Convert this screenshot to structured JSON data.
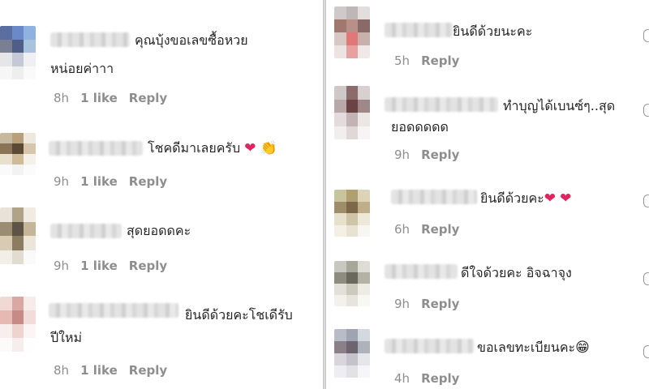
{
  "left": [
    {
      "text_line1": "คุณบุ้งขอเลขซื้อหวย",
      "text_line2": "หน่อยค่าาา",
      "time": "8h",
      "likes": "1 like",
      "reply": "Reply"
    },
    {
      "text_line1": "โชคดีมาเลยครับ",
      "time": "9h",
      "likes": "1 like",
      "reply": "Reply",
      "emoji_heart": "❤",
      "emoji_clap": "👏"
    },
    {
      "text_line1": "สุดยอดดคะ",
      "time": "9h",
      "likes": "1 like",
      "reply": "Reply"
    },
    {
      "text_line1": "ยินดีด้วยคะโชเดีรับ",
      "text_line2": "ปีใหม่",
      "time": "8h",
      "likes": "1 like",
      "reply": "Reply"
    }
  ],
  "right": [
    {
      "text_line1": "ยินดีด้วยนะคะ",
      "time": "5h",
      "reply": "Reply"
    },
    {
      "text_line1": "ทำบุญได้เบนซ์ๆ..สุด",
      "text_line2": "ยอดดดดด",
      "time": "9h",
      "reply": "Reply"
    },
    {
      "text_line1": "ยินดีด้วยคะ",
      "time": "6h",
      "reply": "Reply",
      "emoji_heart": "❤",
      "emoji_heart2": "❤"
    },
    {
      "text_line1": "ดีใจด้วยคะ อิจฉาจุง",
      "time": "9h",
      "reply": "Reply"
    },
    {
      "text_line1": "ขอเลขทะเบียนคะ",
      "time": "4h",
      "reply": "Reply",
      "emoji_grin": "😁"
    }
  ],
  "colors": {
    "text": "#262626",
    "meta": "#8e8e8e",
    "heart": "#e0245e"
  }
}
